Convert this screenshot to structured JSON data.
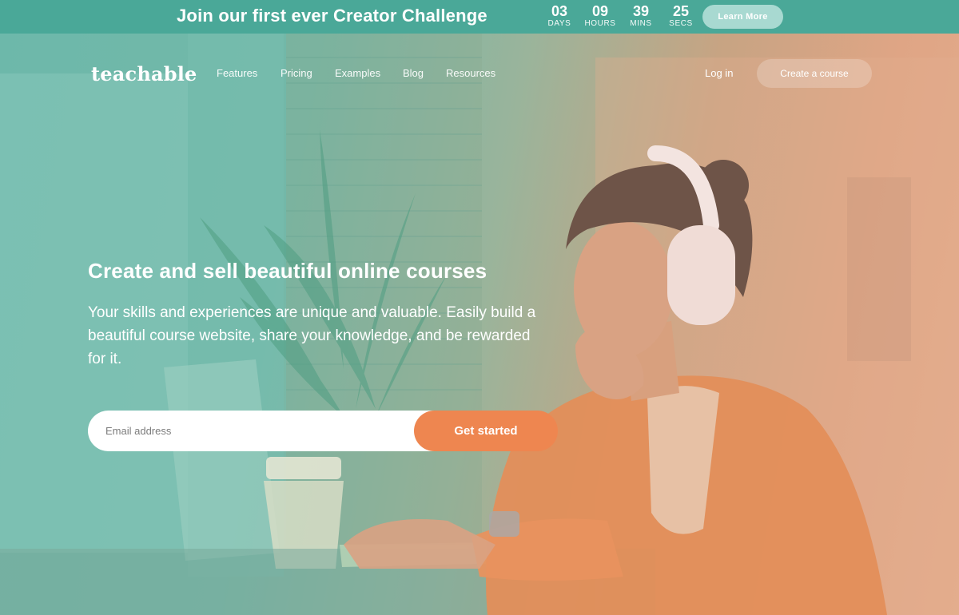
{
  "announcement": {
    "text": "Join our first ever Creator Challenge",
    "countdown": [
      {
        "value": "03",
        "label": "DAYS"
      },
      {
        "value": "09",
        "label": "HOURS"
      },
      {
        "value": "39",
        "label": "MINS"
      },
      {
        "value": "25",
        "label": "SECS"
      }
    ],
    "button_label": "Learn More"
  },
  "header": {
    "logo": "teachable",
    "nav": [
      {
        "label": "Features"
      },
      {
        "label": "Pricing"
      },
      {
        "label": "Examples"
      },
      {
        "label": "Blog"
      },
      {
        "label": "Resources"
      }
    ],
    "login_label": "Log in",
    "cta_label": "Create a course"
  },
  "hero": {
    "headline": "Create and sell beautiful online courses",
    "subheadline": "Your skills and experiences are unique and valuable. Easily build a beautiful course website, share your knowledge, and be rewarded for it.",
    "email_placeholder": "Email address",
    "submit_label": "Get started"
  },
  "colors": {
    "teal_bar": "#4aa898",
    "teal_overlay": "#6fb7a9",
    "orange_cta": "#ee8650",
    "white": "#ffffff"
  },
  "icons": [
    "hero-photo-illustration"
  ]
}
